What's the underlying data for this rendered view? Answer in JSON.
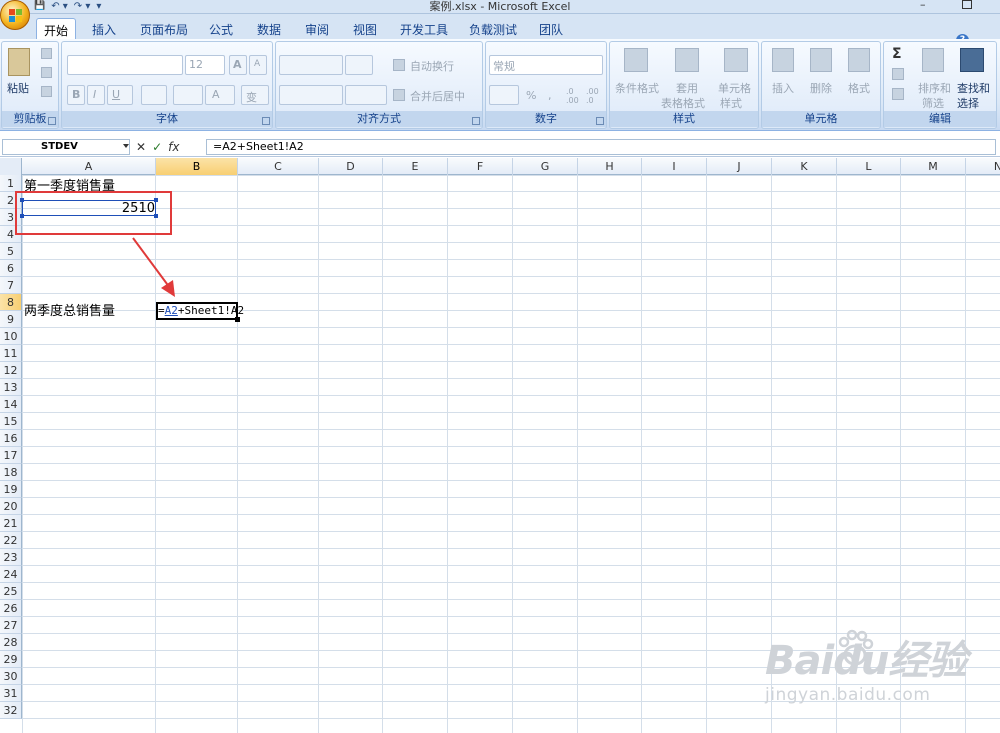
{
  "window": {
    "title": "案例.xlsx - Microsoft Excel",
    "minimize": "–"
  },
  "qat": {
    "save": "💾",
    "undo": "↶ ▾",
    "redo": "↷ ▾",
    "more": "▾"
  },
  "tabs": [
    {
      "label": "开始",
      "active": true
    },
    {
      "label": "插入"
    },
    {
      "label": "页面布局"
    },
    {
      "label": "公式"
    },
    {
      "label": "数据"
    },
    {
      "label": "审阅"
    },
    {
      "label": "视图"
    },
    {
      "label": "开发工具"
    },
    {
      "label": "负载测试"
    },
    {
      "label": "团队"
    }
  ],
  "help": "?",
  "ribbon": {
    "clipboard": {
      "label": "剪贴板",
      "paste": "粘贴"
    },
    "font": {
      "label": "字体",
      "size": "12",
      "bold": "B",
      "italic": "I",
      "underline": "U",
      "grow": "A",
      "shrink": "A",
      "font_color": "A",
      "phonetic": "变"
    },
    "alignment": {
      "label": "对齐方式",
      "wrap": "自动换行",
      "merge": "合并后居中"
    },
    "number": {
      "label": "数字",
      "format": "常规",
      "percent": "%",
      "comma": ",",
      "inc_dec": ".0 .00",
      "dec_dec": ".00 .0"
    },
    "styles": {
      "label": "样式",
      "conditional": "条件格式",
      "table_line1": "套用",
      "table_line2": "表格格式",
      "cell_line1": "单元格",
      "cell_line2": "样式"
    },
    "cells": {
      "label": "单元格",
      "insert": "插入",
      "delete": "删除",
      "format": "格式"
    },
    "editing": {
      "label": "编辑",
      "sort_line1": "排序和",
      "sort_line2": "筛选",
      "find_line1": "查找和",
      "find_line2": "选择"
    }
  },
  "formula_bar": {
    "name_box": "STDEV",
    "cancel": "✕",
    "enter": "✓",
    "fx": "fx",
    "formula": "=A2+Sheet1!A2"
  },
  "columns": [
    "A",
    "B",
    "C",
    "D",
    "E",
    "F",
    "G",
    "H",
    "I",
    "J",
    "K",
    "L",
    "M",
    "N"
  ],
  "rows": [
    "1",
    "2",
    "3",
    "4",
    "5",
    "6",
    "7",
    "8",
    "9",
    "10",
    "11",
    "12",
    "13",
    "14",
    "15",
    "16",
    "17",
    "18",
    "19",
    "20",
    "21",
    "22",
    "23",
    "24",
    "25",
    "26",
    "27",
    "28",
    "29",
    "30",
    "31",
    "32"
  ],
  "selected_column": "B",
  "selected_row": "8",
  "cells": {
    "A1": "第一季度销售量",
    "A2": "2510",
    "A8": "两季度总销售量",
    "B8_prefix": "=",
    "B8_ref1": "A2",
    "B8_suffix": "+Sheet1!A2"
  },
  "colors": {
    "annotation": "#e03a3a",
    "reference": "#1f4fb8",
    "header_selected": "#f8cf72"
  },
  "watermark": {
    "brand": "Baidu经验",
    "url": "jingyan.baidu.com"
  }
}
